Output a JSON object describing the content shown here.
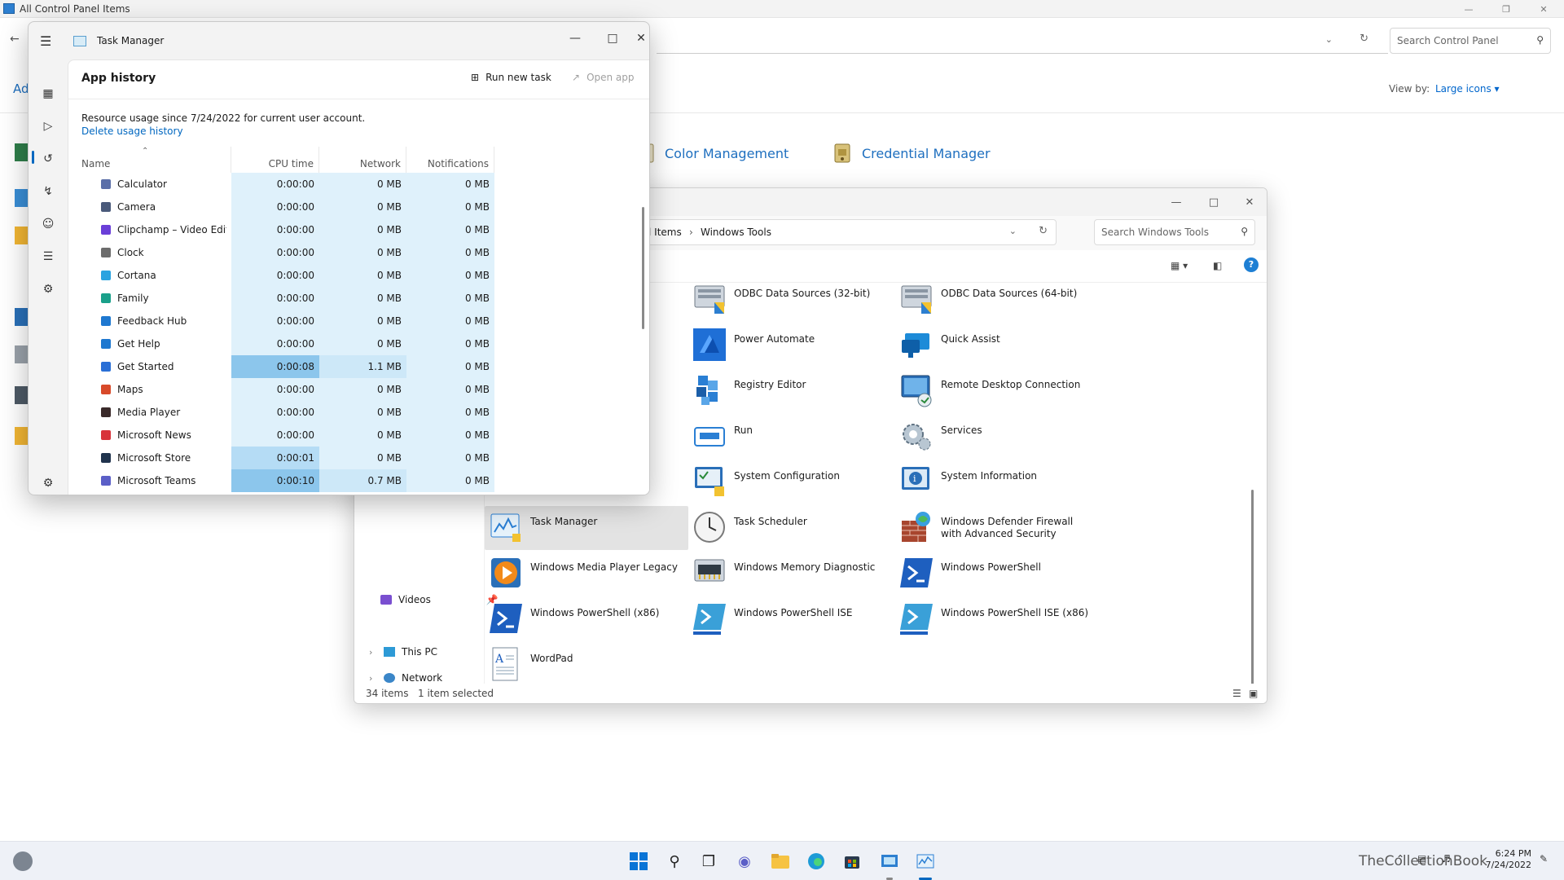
{
  "control_panel": {
    "title": "All Control Panel Items",
    "search_placeholder": "Search Control Panel",
    "view_by_label": "View by:",
    "view_by_value": "Large icons",
    "left_stub": "Ad",
    "items": [
      {
        "label": "Color Management",
        "icon": "color-management-icon"
      },
      {
        "label": "Credential Manager",
        "icon": "credential-manager-icon"
      }
    ]
  },
  "windows_tools": {
    "breadcrumb": [
      "l Items",
      "Windows Tools"
    ],
    "search_placeholder": "Search Windows Tools",
    "nav": [
      {
        "label": "Videos",
        "pinned": true
      },
      {
        "label": "This PC",
        "expandable": true
      },
      {
        "label": "Network",
        "expandable": true
      }
    ],
    "tools": [
      {
        "label": "ODBC Data Sources (32-bit)",
        "icon": "odbc-icon"
      },
      {
        "label": "ODBC Data Sources (64-bit)",
        "icon": "odbc-icon"
      },
      {
        "label": "Power Automate",
        "icon": "power-automate-icon"
      },
      {
        "label": "Quick Assist",
        "icon": "quick-assist-icon"
      },
      {
        "label": "Registry Editor",
        "icon": "registry-editor-icon"
      },
      {
        "label": "Remote Desktop Connection",
        "icon": "remote-desktop-icon"
      },
      {
        "label": "Run",
        "icon": "run-icon"
      },
      {
        "label": "Services",
        "icon": "services-gear-icon"
      },
      {
        "label": "System Configuration",
        "icon": "system-configuration-icon"
      },
      {
        "label": "System Information",
        "icon": "system-information-icon"
      },
      {
        "label": "Task Manager",
        "icon": "task-manager-icon",
        "selected": true
      },
      {
        "label": "Task Scheduler",
        "icon": "clock-icon"
      },
      {
        "label": "Windows Defender Firewall with Advanced Security",
        "icon": "firewall-icon"
      },
      {
        "label": "Windows Media Player Legacy",
        "icon": "media-player-icon"
      },
      {
        "label": "Windows Memory Diagnostic",
        "icon": "memory-chip-icon"
      },
      {
        "label": "Windows PowerShell",
        "icon": "powershell-icon"
      },
      {
        "label": "Windows PowerShell (x86)",
        "icon": "powershell-icon"
      },
      {
        "label": "Windows PowerShell ISE",
        "icon": "powershell-ise-icon"
      },
      {
        "label": "Windows PowerShell ISE (x86)",
        "icon": "powershell-ise-icon"
      },
      {
        "label": "WordPad",
        "icon": "wordpad-icon"
      }
    ],
    "status": {
      "count": "34 items",
      "selection": "1 item selected"
    }
  },
  "task_manager": {
    "title": "Task Manager",
    "page_title": "App history",
    "run_new_task": "Run new task",
    "open_app": "Open app",
    "info": "Resource usage since 7/24/2022 for current user account.",
    "delete_link": "Delete usage history",
    "columns": {
      "name": "Name",
      "cpu": "CPU time",
      "network": "Network",
      "notifications": "Notifications"
    },
    "rows": [
      {
        "name": "Calculator",
        "cpu": "0:00:00",
        "network": "0 MB",
        "notifications": "0 MB",
        "color": "#5b6fa8",
        "heat": ""
      },
      {
        "name": "Camera",
        "cpu": "0:00:00",
        "network": "0 MB",
        "notifications": "0 MB",
        "color": "#4a5a7a",
        "heat": ""
      },
      {
        "name": "Clipchamp – Video Edit...",
        "cpu": "0:00:00",
        "network": "0 MB",
        "notifications": "0 MB",
        "color": "#6a3fd8",
        "heat": ""
      },
      {
        "name": "Clock",
        "cpu": "0:00:00",
        "network": "0 MB",
        "notifications": "0 MB",
        "color": "#6c6c6c",
        "heat": ""
      },
      {
        "name": "Cortana",
        "cpu": "0:00:00",
        "network": "0 MB",
        "notifications": "0 MB",
        "color": "#2aa3e0",
        "heat": ""
      },
      {
        "name": "Family",
        "cpu": "0:00:00",
        "network": "0 MB",
        "notifications": "0 MB",
        "color": "#1aa08a",
        "heat": ""
      },
      {
        "name": "Feedback Hub",
        "cpu": "0:00:00",
        "network": "0 MB",
        "notifications": "0 MB",
        "color": "#1e78d0",
        "heat": ""
      },
      {
        "name": "Get Help",
        "cpu": "0:00:00",
        "network": "0 MB",
        "notifications": "0 MB",
        "color": "#1e78d0",
        "heat": ""
      },
      {
        "name": "Get Started",
        "cpu": "0:00:08",
        "network": "1.1 MB",
        "notifications": "0 MB",
        "color": "#2a6fd6",
        "heat": "hi"
      },
      {
        "name": "Maps",
        "cpu": "0:00:00",
        "network": "0 MB",
        "notifications": "0 MB",
        "color": "#d84a2a",
        "heat": ""
      },
      {
        "name": "Media Player",
        "cpu": "0:00:00",
        "network": "0 MB",
        "notifications": "0 MB",
        "color": "#3a2a2a",
        "heat": ""
      },
      {
        "name": "Microsoft News",
        "cpu": "0:00:00",
        "network": "0 MB",
        "notifications": "0 MB",
        "color": "#d8333a",
        "heat": ""
      },
      {
        "name": "Microsoft Store",
        "cpu": "0:00:01",
        "network": "0 MB",
        "notifications": "0 MB",
        "color": "#20334d",
        "heat": "md"
      },
      {
        "name": "Microsoft Teams",
        "cpu": "0:00:10",
        "network": "0.7 MB",
        "notifications": "0 MB",
        "color": "#5b5fc7",
        "heat": "hi"
      }
    ]
  },
  "taskbar": {
    "clock_time": "6:24 PM",
    "clock_date": "7/24/2022",
    "watermark": "TheCollectionBook",
    "apps": [
      "start-icon",
      "search-icon",
      "task-view-icon",
      "chat-icon",
      "file-explorer-icon",
      "edge-icon",
      "store-icon",
      "control-panel-icon",
      "task-manager-icon"
    ]
  }
}
